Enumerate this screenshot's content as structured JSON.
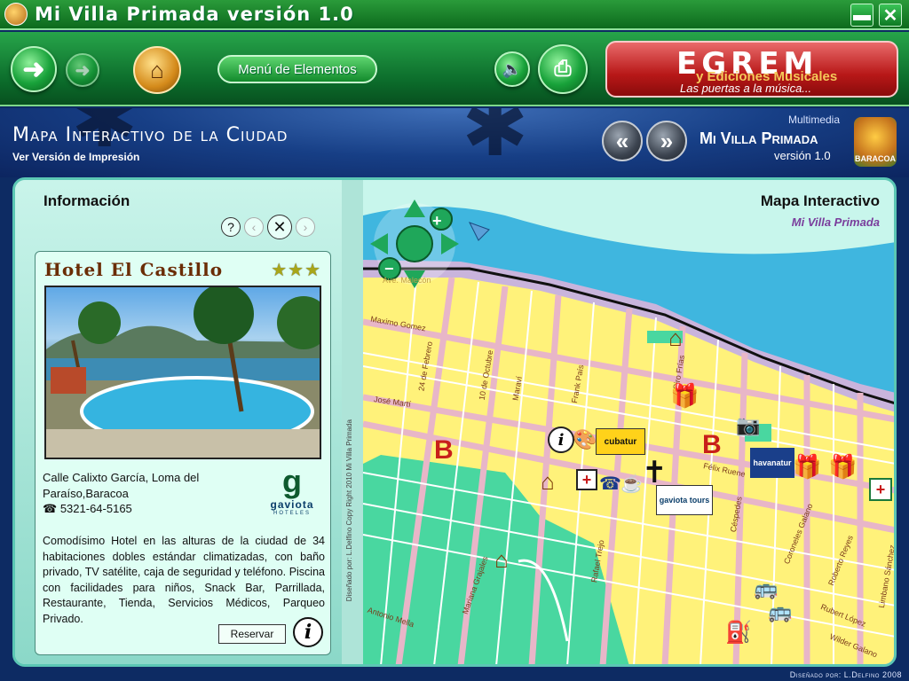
{
  "window": {
    "title": "Mi Villa Primada versión 1.0",
    "minimize_icon": "minimize-icon",
    "close_icon": "close-icon"
  },
  "toolbar": {
    "back_icon": "back-arrow-icon",
    "forward_icon": "forward-arrow-icon",
    "home_icon": "home-icon",
    "menu_label": "Menú de Elementos",
    "sound_icon": "speaker-icon",
    "print_icon": "printer-icon",
    "egrem": {
      "logo": "EGREM",
      "subtitle": "y Ediciones Musicales",
      "slogan": "Las puertas a la música..."
    }
  },
  "banner": {
    "title": "Mapa Interactivo de la Ciudad",
    "print_link": "Ver Versión de Impresión",
    "prev_icon": "double-chevron-left-icon",
    "next_icon": "double-chevron-right-icon",
    "brand": {
      "multimedia": "Multimedia",
      "name": "Mi Villa Primada",
      "version": "versión 1.0",
      "logo_text": "BARACOA"
    }
  },
  "info": {
    "title": "Información",
    "tools": {
      "help": "?",
      "prev": "‹",
      "close": "✕",
      "next": "›"
    },
    "hotel": {
      "name": "Hotel El Castillo",
      "rating": "★★★",
      "address": "Calle Calixto García, Loma del Paraíso,Baracoa",
      "phone": "5321-64-5165",
      "description": "Comodísimo Hotel en las alturas de la ciudad de 34 habitaciones dobles estándar climatizadas, con baño privado, TV satélite, caja de seguridad y teléfono. Piscina con facilidades para niños, Snack Bar, Parrillada, Restaurante, Tienda, Servicios Médicos, Parqueo Privado.",
      "reserve_label": "Reservar",
      "logo": {
        "mark": "g",
        "name": "gaviota",
        "sub": "HOTELES"
      }
    },
    "credit_vertical": "Diseñado por: L.Delfino Copy Right 2010 Mi Villa Primada"
  },
  "map": {
    "title": "Mapa Interactivo",
    "subtitle": "Mi Villa Primada",
    "streets": [
      {
        "text": "Ave. Malecón"
      },
      {
        "text": "Maximo Gomez"
      },
      {
        "text": "José Martí"
      },
      {
        "text": "24 de Febrero"
      },
      {
        "text": "10 de Octubre"
      },
      {
        "text": "Maraví"
      },
      {
        "text": "Frank País"
      },
      {
        "text": "Ciro Frías"
      },
      {
        "text": "Félix Ruene"
      },
      {
        "text": "Céspedes"
      },
      {
        "text": "Coroneles Galano"
      },
      {
        "text": "Roberto Reyes"
      },
      {
        "text": "Limbano Sánchez"
      },
      {
        "text": "Rubert López"
      },
      {
        "text": "Wilder Galano"
      },
      {
        "text": "Rafael Trejo"
      },
      {
        "text": "Mariana Grajales"
      },
      {
        "text": "Antonio Mella"
      }
    ],
    "pois": {
      "cubatur": "cubatur",
      "havanatur": "havanatur",
      "gaviota_tours": "gaviota tours",
      "bank": "B"
    }
  },
  "footer": "Diseñado por: L.Delfino 2008"
}
